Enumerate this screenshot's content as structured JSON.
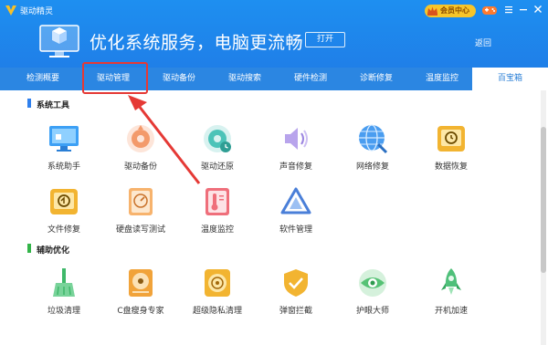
{
  "window": {
    "title": "驱动精灵"
  },
  "header": {
    "slogan": "优化系统服务，电脑更流畅",
    "open_button": "打开",
    "back_link": "返回",
    "vip_label": "会员中心"
  },
  "nav": {
    "tabs": [
      "检测概要",
      "驱动管理",
      "驱动备份",
      "驱动搜索",
      "硬件检测",
      "诊断修复",
      "温度监控"
    ],
    "right_tab": "百宝箱",
    "highlighted_tab": "驱动管理"
  },
  "sections": [
    {
      "title": "系统工具",
      "items": [
        {
          "label": "系统助手",
          "icon": "system-assistant-icon"
        },
        {
          "label": "驱动备份",
          "icon": "driver-backup-icon"
        },
        {
          "label": "驱动还原",
          "icon": "driver-restore-icon"
        },
        {
          "label": "声音修复",
          "icon": "sound-repair-icon"
        },
        {
          "label": "网络修复",
          "icon": "network-repair-icon"
        },
        {
          "label": "数据恢复",
          "icon": "data-recovery-icon"
        },
        {
          "label": "文件修复",
          "icon": "file-repair-icon"
        },
        {
          "label": "硬盘读写测试",
          "icon": "disk-speed-test-icon"
        },
        {
          "label": "温度监控",
          "icon": "temperature-monitor-icon"
        },
        {
          "label": "软件管理",
          "icon": "software-manager-icon"
        }
      ]
    },
    {
      "title": "辅助优化",
      "items": [
        {
          "label": "垃圾清理",
          "icon": "junk-clean-icon"
        },
        {
          "label": "C盘瘦身专家",
          "icon": "c-drive-slim-icon"
        },
        {
          "label": "超级隐私清理",
          "icon": "privacy-clean-icon"
        },
        {
          "label": "弹窗拦截",
          "icon": "popup-block-icon"
        },
        {
          "label": "护眼大师",
          "icon": "eye-care-icon"
        },
        {
          "label": "开机加速",
          "icon": "boot-speedup-icon"
        }
      ]
    }
  ],
  "colors": {
    "header_blue": "#1e8ff0",
    "nav_blue": "#2b86e2",
    "annotation_red": "#e53935",
    "section1_bar": "#2f80ed",
    "section2_bar": "#33b449"
  }
}
